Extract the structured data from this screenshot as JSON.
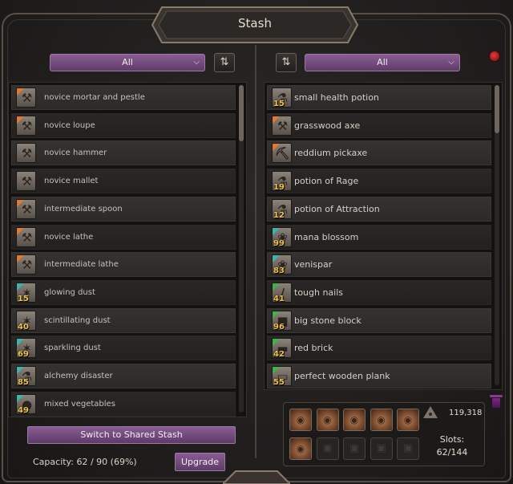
{
  "window": {
    "title": "Stash"
  },
  "left": {
    "filter": "All",
    "sort_icon": "sort-arrows-icon",
    "items": [
      {
        "name": "novice mortar and pestle",
        "icon": "tool-icon",
        "corner": "orange",
        "qty": ""
      },
      {
        "name": "novice loupe",
        "icon": "tool-icon",
        "corner": "orange",
        "qty": ""
      },
      {
        "name": "novice hammer",
        "icon": "tool-icon",
        "corner": "",
        "qty": ""
      },
      {
        "name": "novice mallet",
        "icon": "tool-icon",
        "corner": "",
        "qty": ""
      },
      {
        "name": "intermediate spoon",
        "icon": "tool-icon",
        "corner": "orange",
        "qty": ""
      },
      {
        "name": "novice lathe",
        "icon": "tool-icon",
        "corner": "orange",
        "qty": ""
      },
      {
        "name": "intermediate lathe",
        "icon": "tool-icon",
        "corner": "orange",
        "qty": ""
      },
      {
        "name": "glowing dust",
        "icon": "dust-icon",
        "corner": "teal",
        "qty": "15"
      },
      {
        "name": "scintillating dust",
        "icon": "dust-icon",
        "corner": "",
        "qty": "40"
      },
      {
        "name": "sparkling dust",
        "icon": "dust-icon",
        "corner": "teal",
        "qty": "69"
      },
      {
        "name": "alchemy disaster",
        "icon": "flask-icon",
        "corner": "teal",
        "qty": "85"
      },
      {
        "name": "mixed vegetables",
        "icon": "food-icon",
        "corner": "teal",
        "qty": "49"
      }
    ],
    "shared_button": "Switch to Shared Stash",
    "capacity": "Capacity: 62 / 90 (69%)",
    "upgrade_button": "Upgrade"
  },
  "right": {
    "filter": "All",
    "sort_icon": "sort-arrows-icon",
    "items": [
      {
        "name": "small health potion",
        "icon": "potion-icon",
        "corner": "",
        "qty": "15"
      },
      {
        "name": "grasswood axe",
        "icon": "axe-icon",
        "corner": "orange",
        "qty": ""
      },
      {
        "name": "reddium pickaxe",
        "icon": "pickaxe-icon",
        "corner": "orange",
        "qty": ""
      },
      {
        "name": "potion of Rage",
        "icon": "potion-icon",
        "corner": "",
        "qty": "19"
      },
      {
        "name": "potion of Attraction",
        "icon": "potion-icon",
        "corner": "",
        "qty": "12"
      },
      {
        "name": "mana blossom",
        "icon": "herb-icon",
        "corner": "teal",
        "qty": "99"
      },
      {
        "name": "venispar",
        "icon": "herb-icon",
        "corner": "teal",
        "qty": "83"
      },
      {
        "name": "tough nails",
        "icon": "nails-icon",
        "corner": "green",
        "qty": "41"
      },
      {
        "name": "big stone block",
        "icon": "stone-icon",
        "corner": "green",
        "qty": "96"
      },
      {
        "name": "red brick",
        "icon": "brick-icon",
        "corner": "green",
        "qty": "42"
      },
      {
        "name": "perfect wooden plank",
        "icon": "plank-icon",
        "corner": "green",
        "qty": "55"
      }
    ],
    "bags": [
      {
        "state": "filled",
        "icon": "bag-icon"
      },
      {
        "state": "filled",
        "icon": "bag-icon"
      },
      {
        "state": "filled",
        "icon": "bag-icon"
      },
      {
        "state": "filled",
        "icon": "bag-icon"
      },
      {
        "state": "filled",
        "icon": "bag-icon"
      },
      {
        "state": "filled",
        "icon": "bag-icon"
      },
      {
        "state": "locked",
        "icon": "lock-icon"
      },
      {
        "state": "locked",
        "icon": "lock-icon"
      },
      {
        "state": "locked",
        "icon": "lock-icon"
      },
      {
        "state": "locked",
        "icon": "lock-icon"
      }
    ],
    "gold": "119,318",
    "slots_label": "Slots:",
    "slots_value": "62/144"
  },
  "colors": {
    "accent_purple": "#7a4e86",
    "qty_gold": "#f0c24a",
    "tier_orange": "#e07a2e",
    "tier_teal": "#3cb3b0",
    "tier_green": "#3fb24a",
    "close_red": "#c41e1e"
  }
}
